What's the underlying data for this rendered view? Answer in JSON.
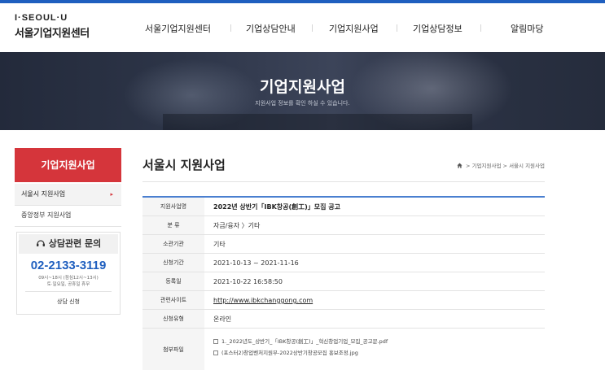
{
  "brand": {
    "logo_top": "I·SEOUL·U",
    "logo_bottom": "서울기업지원센터"
  },
  "nav": {
    "items": [
      "서울기업지원센터",
      "기업상담안내",
      "기업지원사업",
      "기업상담정보",
      "알림마당"
    ]
  },
  "banner": {
    "title": "기업지원사업",
    "subtitle": "지원사업 정보를 확인 하실 수 있습니다."
  },
  "sidebar": {
    "title": "기업지원사업",
    "items": [
      {
        "label": "서울시 지원사업",
        "active": true
      },
      {
        "label": "중앙정부 지원사업",
        "active": false
      }
    ],
    "contact": {
      "heading": "상담관련 문의",
      "phone": "02-2133-3119",
      "hours_line1": "09시~18시 (점심12시~13시)",
      "hours_line2": "토·일요일, 공휴일 휴무",
      "apply_label": "상담 신청"
    }
  },
  "main": {
    "title": "서울시 지원사업",
    "breadcrumb": [
      "기업지원사업",
      "서울시 지원사업"
    ],
    "accent_color": "#4a7fd0"
  },
  "detail": {
    "rows": [
      {
        "label": "지원사업명",
        "value": "2022년 상반기「IBK창공(創工)」모집 공고"
      },
      {
        "label": "분  류",
        "value": "자금/융자 〉기타"
      },
      {
        "label": "소관기관",
        "value": "기타"
      },
      {
        "label": "신청기간",
        "value": "2021-10-13 ~ 2021-11-16"
      },
      {
        "label": "등록일",
        "value": "2021-10-22 16:58:50"
      },
      {
        "label": "관련사이트",
        "value": "http://www.ibkchanggong.com"
      },
      {
        "label": "신청유형",
        "value": "온라인"
      }
    ],
    "files_label": "첨부파일",
    "files": [
      "1._2022년도_상반기_「IBK창공(創工)」_혁신창업기업_모집_공고문.pdf",
      "(포스터2)창업벤처지원부-2022상반기창공모집 홍보조정.jpg"
    ]
  },
  "colors": {
    "brand_red": "#d5353b",
    "phone_blue": "#1f5fbf"
  }
}
